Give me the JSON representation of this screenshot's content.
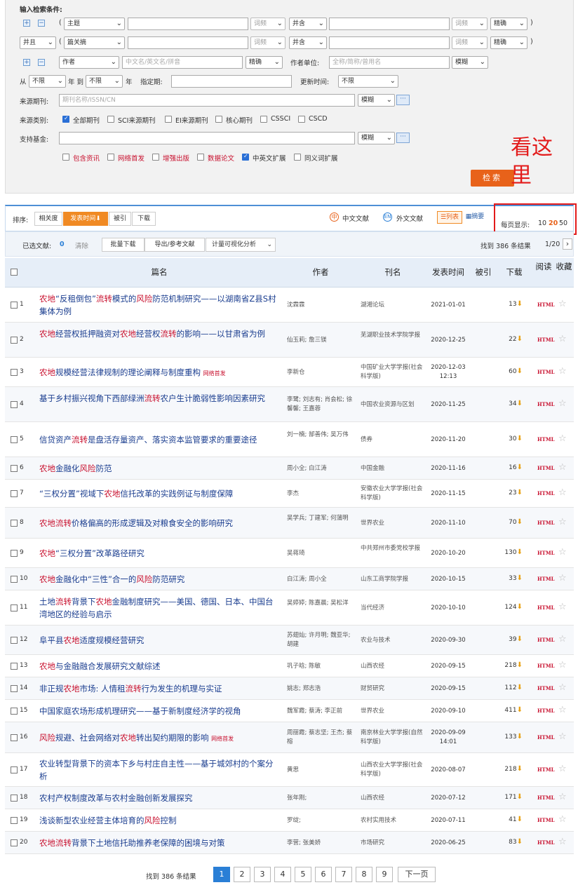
{
  "search": {
    "title": "输入检索条件:",
    "row1": {
      "field": "主题",
      "freq": "词频",
      "op": "并含",
      "freq2": "词频",
      "match": "精确",
      "paren_open": "(",
      "paren_close": ")"
    },
    "row2": {
      "logic": "并且",
      "field": "篇关摘",
      "freq": "词频",
      "op": "并含",
      "freq2": "词频",
      "match": "精确",
      "paren_open": "(",
      "paren_close": ")"
    },
    "row3": {
      "field": "作者",
      "placeholder": "中文名/英文名/拼音",
      "match": "精确",
      "unit_label": "作者单位:",
      "unit_placeholder": "全称/简称/曾用名",
      "unit_match": "模糊"
    },
    "row4": {
      "from_label": "从",
      "from": "不限",
      "year_to": "年 到",
      "to": "不限",
      "year": "年",
      "period_label": "指定期:",
      "update_label": "更新时间:",
      "update": "不限"
    },
    "row5": {
      "label": "来源期刊:",
      "placeholder": "期刊名称/ISSN/CN",
      "match": "模糊",
      "more": "···"
    },
    "row6": {
      "label": "来源类别:",
      "options": [
        "全部期刊",
        "SCI来源期刊",
        "EI来源期刊",
        "核心期刊",
        "CSSCI",
        "CSCD"
      ]
    },
    "row7": {
      "label": "支持基金:",
      "match": "模糊",
      "more": "···"
    },
    "row8": {
      "options": [
        "包含资讯",
        "网络首发",
        "增强出版",
        "数据论文",
        "中英文扩展",
        "同义词扩展"
      ]
    },
    "button": "检索"
  },
  "annotation": "看这里",
  "sortbar": {
    "label": "排序:",
    "buttons": [
      "相关度",
      "发表时间⬇",
      "被引",
      "下载"
    ],
    "chinese": "中文文献",
    "foreign": "外文文献",
    "list": "☰列表",
    "abstract": "▦摘要",
    "per_page_label": "每页显示:",
    "per_page": [
      "10",
      "20",
      "50"
    ]
  },
  "actbar": {
    "selected_label": "已选文献:",
    "selected_count": "0",
    "clear": "清除",
    "batch": "批量下载",
    "export": "导出/参考文献",
    "viz": "计量可视化分析",
    "found": "找到 386 条结果",
    "page": "1/20",
    "next": "›"
  },
  "table": {
    "headers": {
      "title": "篇名",
      "author": "作者",
      "journal": "刊名",
      "date": "发表时间",
      "cited": "被引",
      "download": "下载",
      "read": "阅读",
      "fav": "收藏"
    },
    "rows": [
      {
        "n": "1",
        "title": "农地“反租倒包”流转模式的风险防范机制研究——以湖南省Z县S村集体为例",
        "author": "沈霖霖",
        "journal": "湖湘论坛",
        "date": "2021-01-01",
        "dl": "13"
      },
      {
        "n": "2",
        "title": "农地经营权抵押融资对农地经营权流转的影响——以甘肃省为例",
        "author": "仙玉莉; 詹三镁",
        "journal": "芜湖职业技术学院学报",
        "date": "2020-12-25",
        "dl": "22"
      },
      {
        "n": "3",
        "title": "农地规模经营法律规制的理论阐释与制度重构",
        "tag": "网络首发",
        "author": "李新仓",
        "journal": "中国矿业大学学报(社会科学版)",
        "date": "2020-12-03 12:13",
        "dl": "60"
      },
      {
        "n": "4",
        "title": "基于乡村振兴视角下西部绿洲流转农户生计脆弱性影响因素研究",
        "author": "李鹭; 刘志有; 肖会松; 徐馨馨; 王嘉蓉",
        "journal": "中国农业资源与区划",
        "date": "2020-11-25",
        "dl": "34"
      },
      {
        "n": "5",
        "title": "信贷资产流转是盘活存量资产、落实资本监管要求的重要途径",
        "author": "刘一楠; 郜善伟; 吴万伟",
        "journal": "债券",
        "date": "2020-11-20",
        "dl": "30"
      },
      {
        "n": "6",
        "title": "农地金融化风险防范",
        "author": "周小全; 白江涛",
        "journal": "中国金融",
        "date": "2020-11-16",
        "dl": "16"
      },
      {
        "n": "7",
        "title": "“三权分置”视域下农地信托改革的实践例证与制度保障",
        "author": "李杰",
        "journal": "安徽农业大学学报(社会科学版)",
        "date": "2020-11-15",
        "dl": "23"
      },
      {
        "n": "8",
        "title": "农地流转价格偏高的形成逻辑及对粮食安全的影响研究",
        "author": "吴学兵; 丁建军; 何蒲明",
        "journal": "世界农业",
        "date": "2020-11-10",
        "dl": "70"
      },
      {
        "n": "9",
        "title": "农地“三权分置”改革路径研究",
        "author": "吴蒋琦",
        "journal": "中共郑州市委党校学报",
        "date": "2020-10-20",
        "dl": "130"
      },
      {
        "n": "10",
        "title": "农地金融化中“三性”合一的风险防范研究",
        "author": "白江涛; 周小全",
        "journal": "山东工商学院学报",
        "date": "2020-10-15",
        "dl": "33"
      },
      {
        "n": "11",
        "title": "土地流转背景下农地金融制度研究——美国、德国、日本、中国台湾地区的经验与启示",
        "author": "吴婷婷; 陈嘉晨; 吴松洋",
        "journal": "当代经济",
        "date": "2020-10-10",
        "dl": "124"
      },
      {
        "n": "12",
        "title": "阜平县农地适度规模经营研究",
        "author": "苏翅灿; 许月明; 魏亚华; 胡建",
        "journal": "农业与技术",
        "date": "2020-09-30",
        "dl": "39"
      },
      {
        "n": "13",
        "title": "农地与金融融合发展研究文献综述",
        "author": "巩子晗; 陈敏",
        "journal": "山西农经",
        "date": "2020-09-15",
        "dl": "218"
      },
      {
        "n": "14",
        "title": "非正规农地市场: 人情租流转行为发生的机理与实证",
        "author": "姚志; 郑志浩",
        "journal": "财贸研究",
        "date": "2020-09-15",
        "dl": "112"
      },
      {
        "n": "15",
        "title": "中国家庭农场形成机理研究——基于新制度经济学的视角",
        "author": "魏军霞; 蔡涛; 李正前",
        "journal": "世界农业",
        "date": "2020-09-10",
        "dl": "411"
      },
      {
        "n": "16",
        "title": "风险规避、社会网络对农地转出契约期限的影响",
        "tag": "网络首发",
        "author": "周丽霞; 蔡志坚; 王杰; 蔡榕",
        "journal": "南京林业大学学报(自然科学版)",
        "date": "2020-09-09 14:01",
        "dl": "133"
      },
      {
        "n": "17",
        "title": "农业转型背景下的资本下乡与村庄自主性——基于城郊村的个案分析",
        "author": "黄思",
        "journal": "山西农业大学学报(社会科学版)",
        "date": "2020-08-07",
        "dl": "218"
      },
      {
        "n": "18",
        "title": "农村产权制度改革与农村金融创新发展探究",
        "author": "张年刚;",
        "journal": "山西农经",
        "date": "2020-07-12",
        "dl": "171"
      },
      {
        "n": "19",
        "title": "浅谈新型农业经营主体培育的风险控制",
        "author": "罗绽;",
        "journal": "农村实用技术",
        "date": "2020-07-11",
        "dl": "41"
      },
      {
        "n": "20",
        "title": "农地流转背景下土地信托助推养老保障的困境与对策",
        "author": "李营; 张美娇",
        "journal": "市场研究",
        "date": "2020-06-25",
        "dl": "83"
      }
    ],
    "html_label": "HTML",
    "star": "☆",
    "dl_icon": "⬇"
  },
  "pager": {
    "found": "找到 386 条结果",
    "pages": [
      "1",
      "2",
      "3",
      "4",
      "5",
      "6",
      "7",
      "8",
      "9"
    ],
    "next": "下一页"
  },
  "colors": {
    "accent": "#2a7fd6",
    "orange": "#e8621a",
    "highlight": "#c8102e",
    "title_link": "#1a3d8f"
  }
}
